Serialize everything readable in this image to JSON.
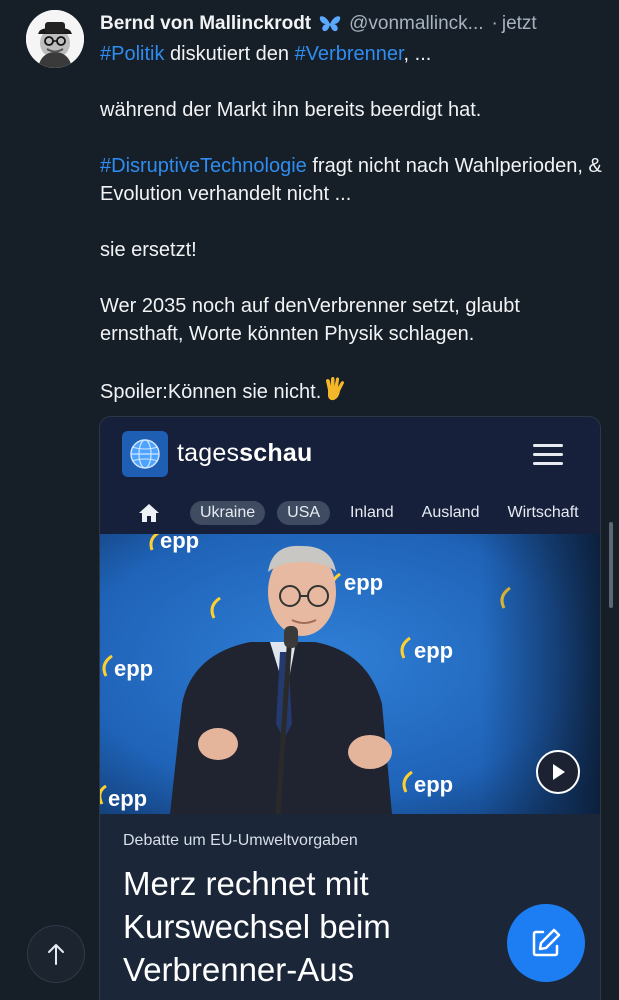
{
  "post": {
    "author_name": "Bernd von Mallinckrodt",
    "verified_emoji": "butterfly-icon",
    "handle": "@vonmallinck...",
    "separator": "·",
    "time": "jetzt",
    "paragraphs": [
      [
        {
          "type": "hashtag",
          "text": "#Politik"
        },
        {
          "type": "text",
          "text": " diskutiert den "
        },
        {
          "type": "hashtag",
          "text": "#Verbrenner"
        },
        {
          "type": "text",
          "text": ", ..."
        }
      ],
      [
        {
          "type": "text",
          "text": "während der Markt ihn bereits beerdigt hat."
        }
      ],
      [
        {
          "type": "hashtag",
          "text": "#DisruptiveTechnologie"
        },
        {
          "type": "text",
          "text": " fragt nicht nach Wahlperioden, & Evolution verhandelt nicht ..."
        }
      ],
      [
        {
          "type": "text",
          "text": "sie ersetzt!"
        }
      ],
      [
        {
          "type": "text",
          "text": "Wer 2035 noch auf denVerbrenner setzt, glaubt ernsthaft, Worte könnten Physik schlagen."
        }
      ],
      [
        {
          "type": "text",
          "text": "Spoiler:Können sie nicht."
        }
      ]
    ],
    "end_emoji": "vulcan-salute-icon"
  },
  "card": {
    "site": {
      "prefix": "tages",
      "bold": "schau"
    },
    "nav": {
      "home_icon": "home-icon",
      "pills": [
        "Ukraine",
        "USA"
      ],
      "links": [
        "Inland",
        "Ausland",
        "Wirtschaft"
      ]
    },
    "image_logo_text": "epp",
    "play_icon": "play-icon",
    "topline": "Debatte um EU-Umweltvorgaben",
    "headline": "Merz rechnet mit Kurswechsel beim Verbrenner-Aus"
  },
  "chrome": {
    "scroll_up_icon": "arrow-up-icon",
    "compose_icon": "compose-icon"
  },
  "colors": {
    "background": "#161e27",
    "hashtag": "#2f8df0",
    "muted": "#a7b3c1",
    "accent": "#1d7df2",
    "card_bg": "#16203a",
    "image_blue": "#1f63b8"
  }
}
